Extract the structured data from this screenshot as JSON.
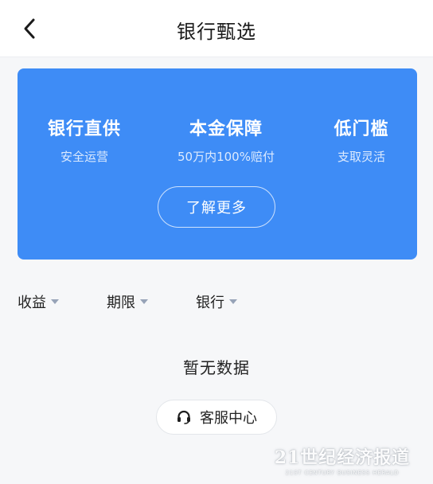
{
  "header": {
    "title": "银行甄选",
    "back_icon": "chevron-left-icon"
  },
  "banner": {
    "background_color": "#3e8cf6",
    "features": [
      {
        "title": "银行直供",
        "subtitle": "安全运营"
      },
      {
        "title": "本金保障",
        "subtitle": "50万内100%赔付"
      },
      {
        "title": "低门槛",
        "subtitle": "支取灵活"
      }
    ],
    "more_button": "了解更多"
  },
  "filters": [
    {
      "label": "收益",
      "icon": "caret-down-icon"
    },
    {
      "label": "期限",
      "icon": "caret-down-icon"
    },
    {
      "label": "银行",
      "icon": "caret-down-icon"
    }
  ],
  "empty_state": {
    "text": "暂无数据"
  },
  "service_button": {
    "label": "客服中心",
    "icon": "headset-icon"
  },
  "watermark": {
    "main": "21世纪经济报道",
    "sub": "21ST CENTURY BUSINESS HERALD"
  }
}
